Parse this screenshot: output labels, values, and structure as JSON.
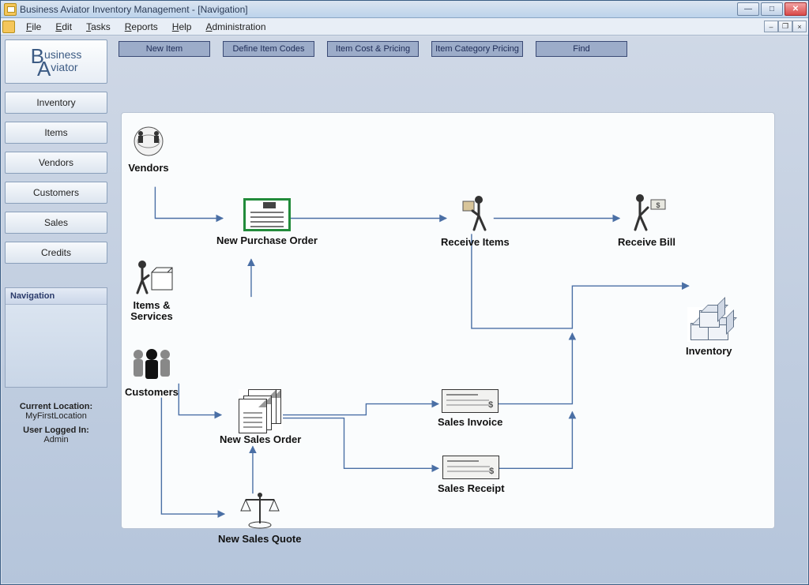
{
  "window": {
    "title": "Business Aviator Inventory Management - [Navigation]"
  },
  "menus": {
    "file": "File",
    "edit": "Edit",
    "tasks": "Tasks",
    "reports": "Reports",
    "help": "Help",
    "administration": "Administration"
  },
  "logo": {
    "line1": "usiness",
    "line2": "viator",
    "bigB": "B",
    "bigA": "A"
  },
  "sidebar": {
    "buttons": [
      "Inventory",
      "Items",
      "Vendors",
      "Customers",
      "Sales",
      "Credits"
    ],
    "panel_title": "Navigation"
  },
  "status": {
    "loc_label": "Current Location:",
    "loc_value": "MyFirstLocation",
    "user_label": "User Logged In:",
    "user_value": "Admin"
  },
  "toolbar": {
    "new_item": "New Item",
    "define_codes": "Define Item Codes",
    "cost_pricing": "Item Cost & Pricing",
    "cat_pricing": "Item Category Pricing",
    "find": "Find"
  },
  "flow": {
    "vendors": "Vendors",
    "new_po": "New Purchase Order",
    "receive_items": "Receive Items",
    "receive_bill": "Receive Bill",
    "items_services_l1": "Items &",
    "items_services_l2": "Services",
    "customers": "Customers",
    "new_sales_order": "New Sales Order",
    "sales_invoice": "Sales Invoice",
    "sales_receipt": "Sales Receipt",
    "inventory": "Inventory",
    "new_sales_quote": "New Sales Quote"
  }
}
